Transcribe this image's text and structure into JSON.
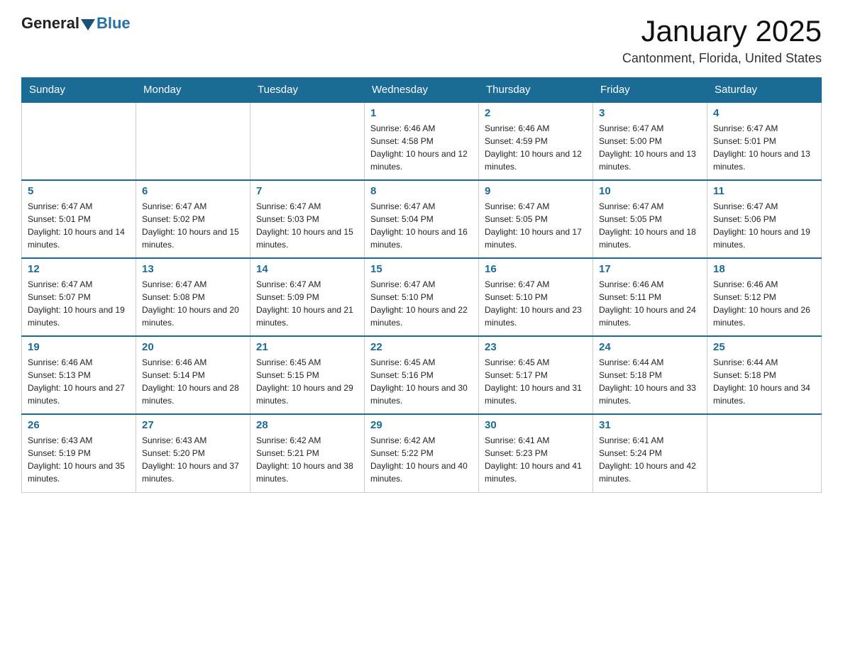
{
  "header": {
    "logo_general": "General",
    "logo_blue": "Blue",
    "month_title": "January 2025",
    "location": "Cantonment, Florida, United States"
  },
  "weekdays": [
    "Sunday",
    "Monday",
    "Tuesday",
    "Wednesday",
    "Thursday",
    "Friday",
    "Saturday"
  ],
  "weeks": [
    [
      {
        "day": "",
        "sunrise": "",
        "sunset": "",
        "daylight": ""
      },
      {
        "day": "",
        "sunrise": "",
        "sunset": "",
        "daylight": ""
      },
      {
        "day": "",
        "sunrise": "",
        "sunset": "",
        "daylight": ""
      },
      {
        "day": "1",
        "sunrise": "Sunrise: 6:46 AM",
        "sunset": "Sunset: 4:58 PM",
        "daylight": "Daylight: 10 hours and 12 minutes."
      },
      {
        "day": "2",
        "sunrise": "Sunrise: 6:46 AM",
        "sunset": "Sunset: 4:59 PM",
        "daylight": "Daylight: 10 hours and 12 minutes."
      },
      {
        "day": "3",
        "sunrise": "Sunrise: 6:47 AM",
        "sunset": "Sunset: 5:00 PM",
        "daylight": "Daylight: 10 hours and 13 minutes."
      },
      {
        "day": "4",
        "sunrise": "Sunrise: 6:47 AM",
        "sunset": "Sunset: 5:01 PM",
        "daylight": "Daylight: 10 hours and 13 minutes."
      }
    ],
    [
      {
        "day": "5",
        "sunrise": "Sunrise: 6:47 AM",
        "sunset": "Sunset: 5:01 PM",
        "daylight": "Daylight: 10 hours and 14 minutes."
      },
      {
        "day": "6",
        "sunrise": "Sunrise: 6:47 AM",
        "sunset": "Sunset: 5:02 PM",
        "daylight": "Daylight: 10 hours and 15 minutes."
      },
      {
        "day": "7",
        "sunrise": "Sunrise: 6:47 AM",
        "sunset": "Sunset: 5:03 PM",
        "daylight": "Daylight: 10 hours and 15 minutes."
      },
      {
        "day": "8",
        "sunrise": "Sunrise: 6:47 AM",
        "sunset": "Sunset: 5:04 PM",
        "daylight": "Daylight: 10 hours and 16 minutes."
      },
      {
        "day": "9",
        "sunrise": "Sunrise: 6:47 AM",
        "sunset": "Sunset: 5:05 PM",
        "daylight": "Daylight: 10 hours and 17 minutes."
      },
      {
        "day": "10",
        "sunrise": "Sunrise: 6:47 AM",
        "sunset": "Sunset: 5:05 PM",
        "daylight": "Daylight: 10 hours and 18 minutes."
      },
      {
        "day": "11",
        "sunrise": "Sunrise: 6:47 AM",
        "sunset": "Sunset: 5:06 PM",
        "daylight": "Daylight: 10 hours and 19 minutes."
      }
    ],
    [
      {
        "day": "12",
        "sunrise": "Sunrise: 6:47 AM",
        "sunset": "Sunset: 5:07 PM",
        "daylight": "Daylight: 10 hours and 19 minutes."
      },
      {
        "day": "13",
        "sunrise": "Sunrise: 6:47 AM",
        "sunset": "Sunset: 5:08 PM",
        "daylight": "Daylight: 10 hours and 20 minutes."
      },
      {
        "day": "14",
        "sunrise": "Sunrise: 6:47 AM",
        "sunset": "Sunset: 5:09 PM",
        "daylight": "Daylight: 10 hours and 21 minutes."
      },
      {
        "day": "15",
        "sunrise": "Sunrise: 6:47 AM",
        "sunset": "Sunset: 5:10 PM",
        "daylight": "Daylight: 10 hours and 22 minutes."
      },
      {
        "day": "16",
        "sunrise": "Sunrise: 6:47 AM",
        "sunset": "Sunset: 5:10 PM",
        "daylight": "Daylight: 10 hours and 23 minutes."
      },
      {
        "day": "17",
        "sunrise": "Sunrise: 6:46 AM",
        "sunset": "Sunset: 5:11 PM",
        "daylight": "Daylight: 10 hours and 24 minutes."
      },
      {
        "day": "18",
        "sunrise": "Sunrise: 6:46 AM",
        "sunset": "Sunset: 5:12 PM",
        "daylight": "Daylight: 10 hours and 26 minutes."
      }
    ],
    [
      {
        "day": "19",
        "sunrise": "Sunrise: 6:46 AM",
        "sunset": "Sunset: 5:13 PM",
        "daylight": "Daylight: 10 hours and 27 minutes."
      },
      {
        "day": "20",
        "sunrise": "Sunrise: 6:46 AM",
        "sunset": "Sunset: 5:14 PM",
        "daylight": "Daylight: 10 hours and 28 minutes."
      },
      {
        "day": "21",
        "sunrise": "Sunrise: 6:45 AM",
        "sunset": "Sunset: 5:15 PM",
        "daylight": "Daylight: 10 hours and 29 minutes."
      },
      {
        "day": "22",
        "sunrise": "Sunrise: 6:45 AM",
        "sunset": "Sunset: 5:16 PM",
        "daylight": "Daylight: 10 hours and 30 minutes."
      },
      {
        "day": "23",
        "sunrise": "Sunrise: 6:45 AM",
        "sunset": "Sunset: 5:17 PM",
        "daylight": "Daylight: 10 hours and 31 minutes."
      },
      {
        "day": "24",
        "sunrise": "Sunrise: 6:44 AM",
        "sunset": "Sunset: 5:18 PM",
        "daylight": "Daylight: 10 hours and 33 minutes."
      },
      {
        "day": "25",
        "sunrise": "Sunrise: 6:44 AM",
        "sunset": "Sunset: 5:18 PM",
        "daylight": "Daylight: 10 hours and 34 minutes."
      }
    ],
    [
      {
        "day": "26",
        "sunrise": "Sunrise: 6:43 AM",
        "sunset": "Sunset: 5:19 PM",
        "daylight": "Daylight: 10 hours and 35 minutes."
      },
      {
        "day": "27",
        "sunrise": "Sunrise: 6:43 AM",
        "sunset": "Sunset: 5:20 PM",
        "daylight": "Daylight: 10 hours and 37 minutes."
      },
      {
        "day": "28",
        "sunrise": "Sunrise: 6:42 AM",
        "sunset": "Sunset: 5:21 PM",
        "daylight": "Daylight: 10 hours and 38 minutes."
      },
      {
        "day": "29",
        "sunrise": "Sunrise: 6:42 AM",
        "sunset": "Sunset: 5:22 PM",
        "daylight": "Daylight: 10 hours and 40 minutes."
      },
      {
        "day": "30",
        "sunrise": "Sunrise: 6:41 AM",
        "sunset": "Sunset: 5:23 PM",
        "daylight": "Daylight: 10 hours and 41 minutes."
      },
      {
        "day": "31",
        "sunrise": "Sunrise: 6:41 AM",
        "sunset": "Sunset: 5:24 PM",
        "daylight": "Daylight: 10 hours and 42 minutes."
      },
      {
        "day": "",
        "sunrise": "",
        "sunset": "",
        "daylight": ""
      }
    ]
  ]
}
